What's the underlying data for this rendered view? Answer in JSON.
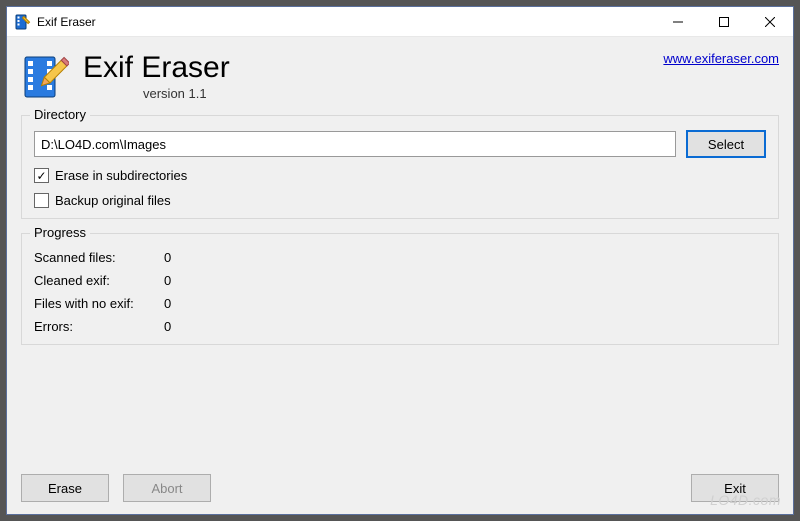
{
  "window": {
    "title": "Exif Eraser"
  },
  "header": {
    "app_title": "Exif Eraser",
    "version": "version 1.1",
    "site_link": "www.exiferaser.com"
  },
  "directory": {
    "group_label": "Directory",
    "path": "D:\\LO4D.com\\Images",
    "select_label": "Select",
    "erase_subdirs_label": "Erase in subdirectories",
    "erase_subdirs_checked": true,
    "backup_label": "Backup original files",
    "backup_checked": false
  },
  "progress": {
    "group_label": "Progress",
    "rows": [
      {
        "label": "Scanned files:",
        "value": "0"
      },
      {
        "label": "Cleaned exif:",
        "value": "0"
      },
      {
        "label": "Files with no exif:",
        "value": "0"
      },
      {
        "label": "Errors:",
        "value": "0"
      }
    ]
  },
  "footer": {
    "erase_label": "Erase",
    "abort_label": "Abort",
    "exit_label": "Exit"
  },
  "watermark": "LO4D.com"
}
